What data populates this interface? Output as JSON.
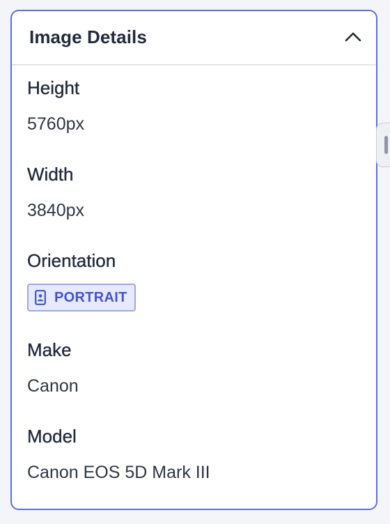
{
  "panel": {
    "title": "Image Details",
    "collapse_icon": "chevron-up-icon"
  },
  "fields": {
    "height": {
      "label": "Height",
      "value": "5760px"
    },
    "width": {
      "label": "Width",
      "value": "3840px"
    },
    "orientation": {
      "label": "Orientation",
      "value": "PORTRAIT",
      "icon": "portrait-icon"
    },
    "make": {
      "label": "Make",
      "value": "Canon"
    },
    "model": {
      "label": "Model",
      "value": "Canon EOS 5D Mark III"
    }
  },
  "colors": {
    "accent": "#5b6de0",
    "badge_bg": "#e7eafc",
    "badge_text": "#4453cc",
    "text": "#222a3d"
  },
  "side_tab": {
    "icon": "drag-handle-icon"
  }
}
